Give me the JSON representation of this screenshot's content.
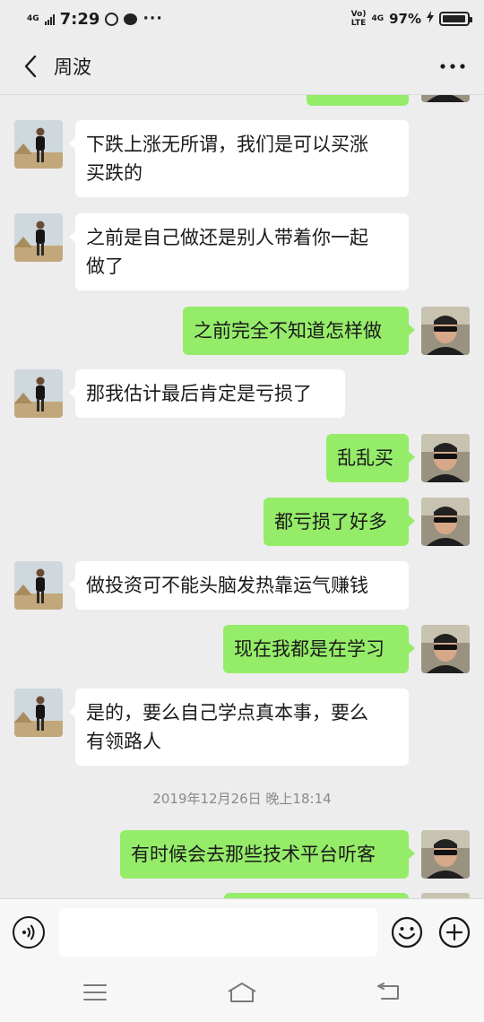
{
  "status_bar": {
    "network": "4G",
    "time": "7:29",
    "volte_top": "Vo)",
    "volte_bottom": "LTE",
    "network2": "4G",
    "battery": "97%",
    "battery_level": 0.97
  },
  "header": {
    "title": "周波",
    "back_icon": "back-chevron-icon",
    "more_icon": "more-dots-icon"
  },
  "colors": {
    "sent_bubble": "#95ec69",
    "received_bubble": "#ffffff",
    "background": "#ededed"
  },
  "messages": [
    {
      "side": "left",
      "lines": [
        "下跌上涨无所谓，我们是可以买涨",
        "买跌的"
      ]
    },
    {
      "side": "left",
      "lines": [
        "之前是自己做还是别人带着你一起",
        "做了"
      ]
    },
    {
      "side": "right",
      "lines": [
        "之前完全不知道怎样做"
      ]
    },
    {
      "side": "left",
      "lines": [
        "那我估计最后肯定是亏损了"
      ]
    },
    {
      "side": "right",
      "lines": [
        "乱乱买"
      ]
    },
    {
      "side": "right",
      "lines": [
        "都亏损了好多"
      ]
    },
    {
      "side": "left",
      "lines": [
        "做投资可不能头脑发热靠运气赚钱"
      ]
    },
    {
      "side": "right",
      "lines": [
        "现在我都是在学习"
      ]
    },
    {
      "side": "left",
      "lines": [
        "是的，要么自己学点真本事，要么",
        "有领路人"
      ]
    },
    {
      "side": "right",
      "lines": [
        "有时候会去那些技术平台听客"
      ]
    }
  ],
  "timestamp": "2019年12月26日 晚上18:14",
  "input_bar": {
    "placeholder": "",
    "voice_icon": "voice-icon",
    "emoji_icon": "emoji-icon",
    "plus_icon": "plus-icon"
  },
  "nav_bar": {
    "menu_icon": "menu-icon",
    "home_icon": "home-icon",
    "back_icon": "back-icon"
  }
}
